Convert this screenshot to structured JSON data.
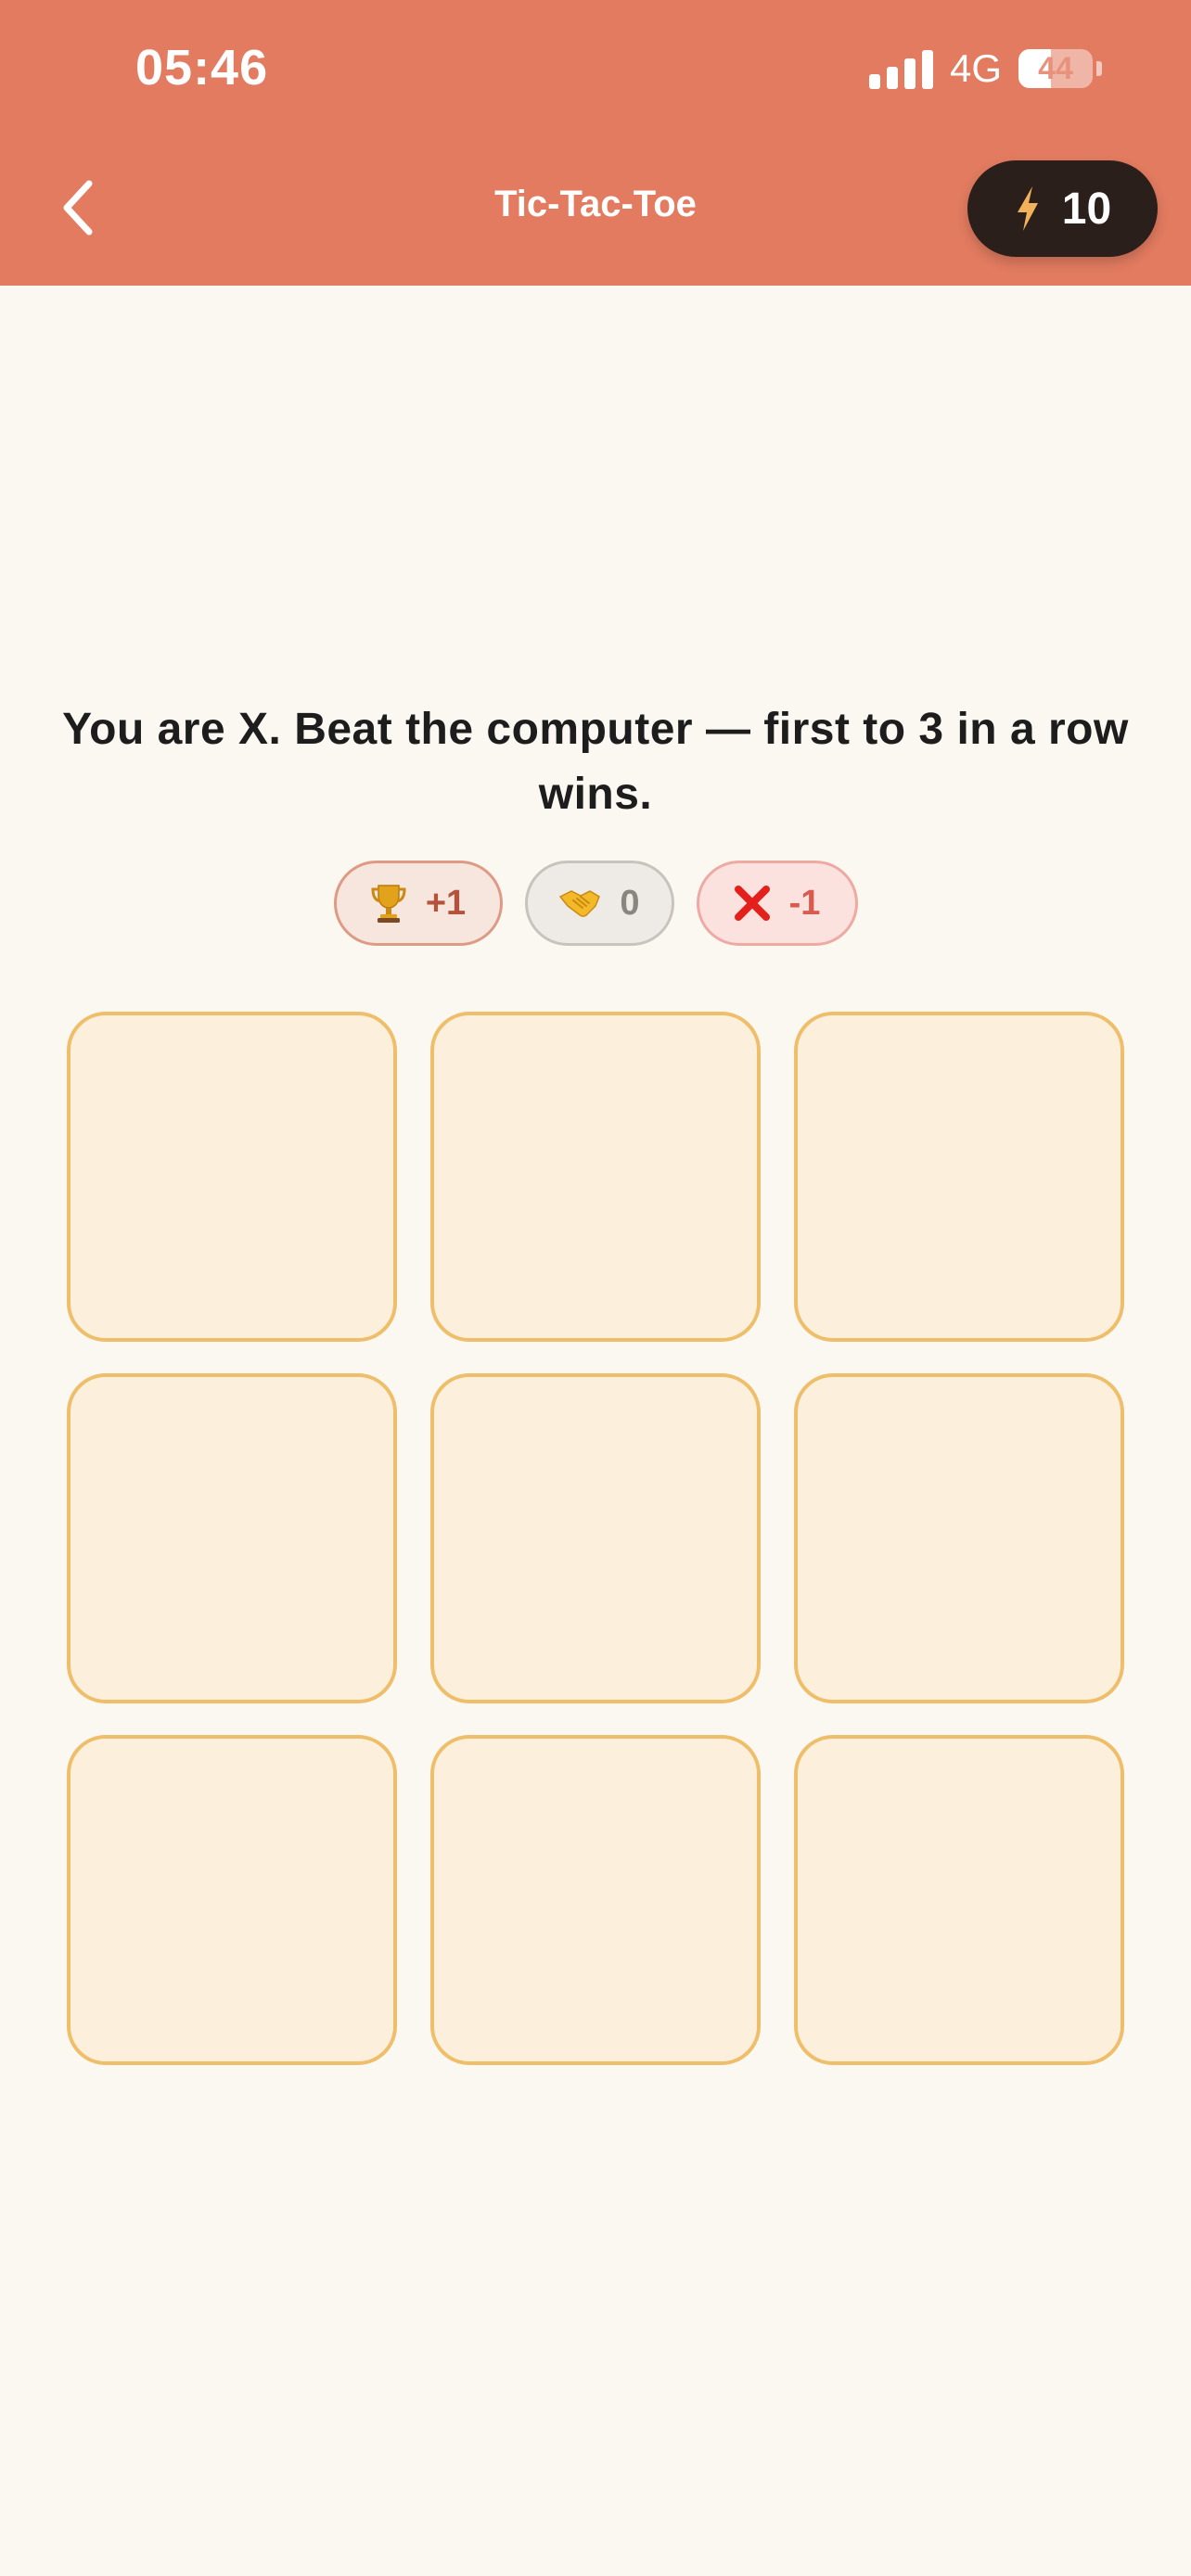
{
  "status_bar": {
    "time": "05:46",
    "network": "4G",
    "battery_level": "44",
    "battery_fraction": 0.44,
    "signal_bars": 4
  },
  "header": {
    "title": "Tic-Tac-Toe",
    "back_icon": "chevron-left-icon",
    "energy_icon": "lightning-bolt-icon",
    "energy_count": "10",
    "background_color": "#E27B60"
  },
  "instructions": "You are X. Beat the computer — first to 3 in a row wins.",
  "scores": {
    "win": {
      "icon": "trophy-icon",
      "value": "+1"
    },
    "draw": {
      "icon": "handshake-icon",
      "value": "0"
    },
    "loss": {
      "icon": "cross-mark-icon",
      "value": "-1"
    }
  },
  "board": {
    "cells": [
      "",
      "",
      "",
      "",
      "",
      "",
      "",
      "",
      ""
    ]
  },
  "colors": {
    "page_background": "#FBF8F2",
    "cell_fill": "#FCF0DC",
    "cell_border": "#EFBE6A",
    "energy_pill": "#2A1F1A"
  }
}
